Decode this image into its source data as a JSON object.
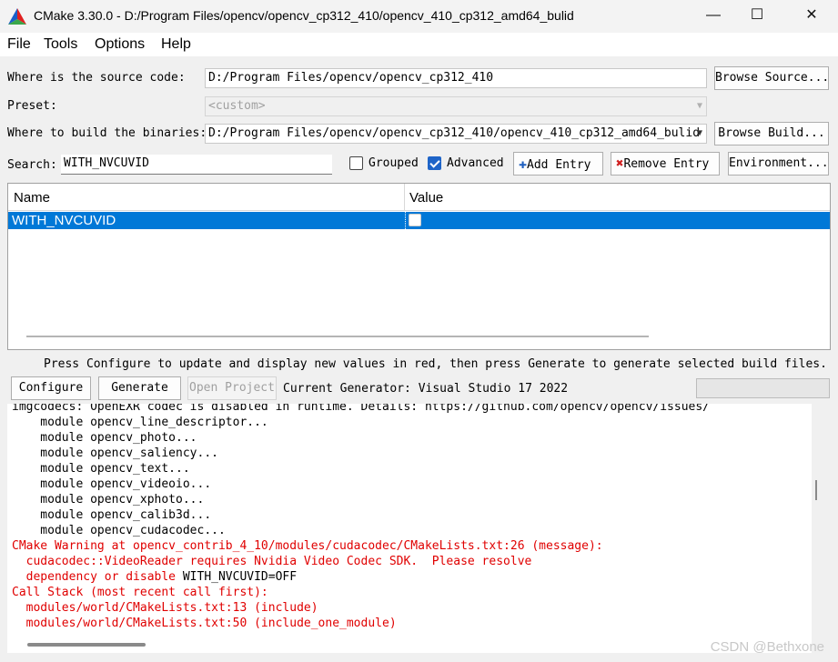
{
  "window": {
    "title": "CMake 3.30.0 - D:/Program Files/opencv/opencv_cp312_410/opencv_410_cp312_amd64_bulid",
    "minimize": "—",
    "maximize": "☐",
    "close": "✕"
  },
  "menu": [
    "File",
    "Tools",
    "Options",
    "Help"
  ],
  "source": {
    "label": "Where is the source code:",
    "value": "D:/Program Files/opencv/opencv_cp312_410",
    "browse": "Browse Source..."
  },
  "preset": {
    "label": "Preset:",
    "value": "<custom>"
  },
  "build": {
    "label": "Where to build the binaries:",
    "value": "D:/Program Files/opencv/opencv_cp312_410/opencv_410_cp312_amd64_bulid",
    "browse": "Browse Build..."
  },
  "search": {
    "label": "Search:",
    "value": "WITH_NVCUVID"
  },
  "options": {
    "grouped": {
      "label": "Grouped",
      "checked": false
    },
    "advanced": {
      "label": "Advanced",
      "checked": true
    },
    "add_entry": "Add Entry",
    "remove_entry": "Remove Entry",
    "environment": "Environment..."
  },
  "table": {
    "headers": {
      "name": "Name",
      "value": "Value"
    },
    "rows": [
      {
        "name": "WITH_NVCUVID",
        "checked": false,
        "selected": true
      }
    ]
  },
  "info": "Press Configure to update and display new values in red, then press Generate to generate selected build files.",
  "actions": {
    "configure": "Configure",
    "generate": "Generate",
    "open_project": "Open Project",
    "generator": "Current Generator: Visual Studio 17 2022"
  },
  "output": [
    {
      "text": "imgcodecs: OpenEXR codec is disabled in runtime. Details: https://github.com/opencv/opencv/issues/",
      "red": false
    },
    {
      "text": "    module opencv_line_descriptor...",
      "red": false
    },
    {
      "text": "    module opencv_photo...",
      "red": false
    },
    {
      "text": "    module opencv_saliency...",
      "red": false
    },
    {
      "text": "    module opencv_text...",
      "red": false
    },
    {
      "text": "    module opencv_videoio...",
      "red": false
    },
    {
      "text": "    module opencv_xphoto...",
      "red": false
    },
    {
      "text": "    module opencv_calib3d...",
      "red": false
    },
    {
      "text": "    module opencv_cudacodec...",
      "red": false
    },
    {
      "text": "CMake Warning at opencv_contrib_4_10/modules/cudacodec/CMakeLists.txt:26 (message):",
      "red": true
    },
    {
      "text": "  cudacodec::VideoReader requires Nvidia Video Codec SDK.  Please resolve",
      "red": true
    },
    {
      "text": "  dependency or disable ",
      "red": true,
      "suffix": "WITH_NVCUVID=OFF"
    },
    {
      "text": "Call Stack (most recent call first):",
      "red": true
    },
    {
      "text": "  modules/world/CMakeLists.txt:13 (include)",
      "red": true
    },
    {
      "text": "  modules/world/CMakeLists.txt:50 (include_one_module)",
      "red": true
    }
  ],
  "watermark": "CSDN @Bethxone"
}
